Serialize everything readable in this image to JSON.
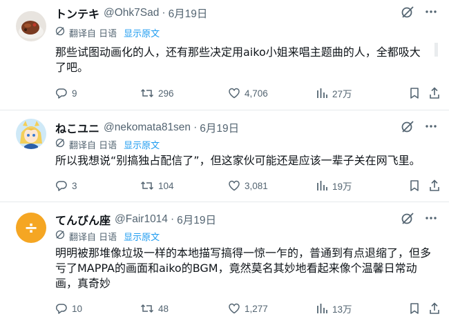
{
  "tweets": [
    {
      "name": "トンテキ",
      "handle": "@Ohk7Sad",
      "date": "6月19日",
      "translate_label": "翻译自 日语",
      "show_original": "显示原文",
      "text": "那些试图动画化的人，还有那些决定用aiko小姐来唱主题曲的人，全都吸大了吧。",
      "replies": "9",
      "retweets": "296",
      "likes": "4,706",
      "views": "27万"
    },
    {
      "name": "ねこユニ",
      "handle": "@nekomata81sen",
      "date": "6月19日",
      "translate_label": "翻译自 日语",
      "show_original": "显示原文",
      "text": "所以我想说“别搞独占配信了”，但这家伙可能还是应该一辈子关在网飞里。",
      "replies": "3",
      "retweets": "104",
      "likes": "3,081",
      "views": "19万"
    },
    {
      "name": "てんびん座",
      "handle": "@Fair1014",
      "date": "6月19日",
      "translate_label": "翻译自 日语",
      "show_original": "显示原文",
      "text": "明明被那堆像垃圾一样的本地描写搞得一惊一乍的，普通到有点退缩了，但多亏了MAPPA的画面和aiko的BGM，竟然莫名其妙地看起来像个温馨日常动画，真奇妙",
      "replies": "10",
      "retweets": "48",
      "likes": "1,277",
      "views": "13万",
      "avatar_glyph": "÷"
    }
  ],
  "colors": {
    "text": "#0f1419",
    "secondary": "#536471",
    "link": "#1d9bf0",
    "avatar_orange": "#f5a623"
  }
}
